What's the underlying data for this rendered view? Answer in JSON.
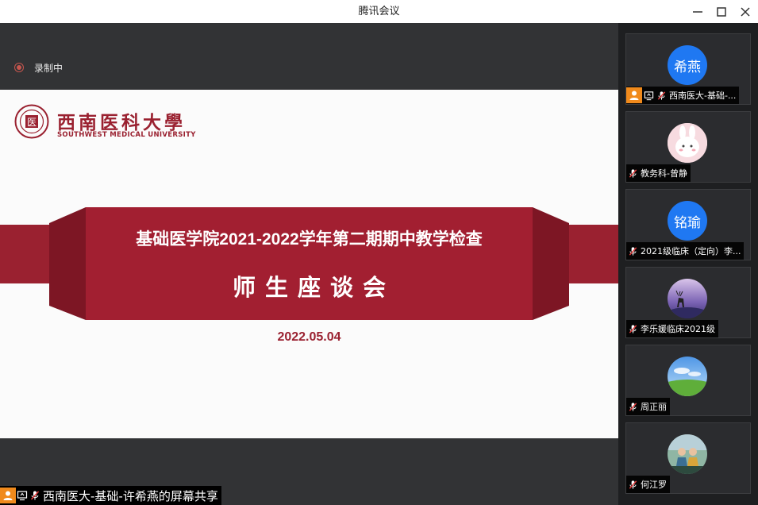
{
  "window": {
    "title": "腾讯会议",
    "controls": [
      "minimize-icon",
      "maximize-icon",
      "close-icon"
    ]
  },
  "recording": {
    "label": "录制中",
    "color": "#c7564e"
  },
  "slide": {
    "logo_text": "西南医科大學",
    "logo_subtitle": "SOUTHWEST MEDICAL UNIVERSITY",
    "title": "基础医学院2021-2022学年第二期期中教学检查",
    "subtitle": "师生座谈会",
    "date": "2022.05.04",
    "brand_color": "#9a2130"
  },
  "share_label": "西南医大-基础-许希燕的屏幕共享",
  "participants": [
    {
      "name": "西南医大-基础-...",
      "avatar_text": "希燕",
      "avatar_type": "text",
      "is_host": true,
      "sharing": true
    },
    {
      "name": "教务科-曾静",
      "avatar_type": "cartoon-bunny"
    },
    {
      "name": "2021级临床（定向）李...",
      "avatar_text": "铭瑜",
      "avatar_type": "text"
    },
    {
      "name": "李乐媛临床2021级",
      "avatar_type": "deer-night"
    },
    {
      "name": "周正丽",
      "avatar_type": "sky-grass"
    },
    {
      "name": "何江罗",
      "avatar_type": "photo-people"
    }
  ],
  "colors": {
    "accent_blue": "#1f78f2",
    "host_orange": "#f08a1c"
  }
}
